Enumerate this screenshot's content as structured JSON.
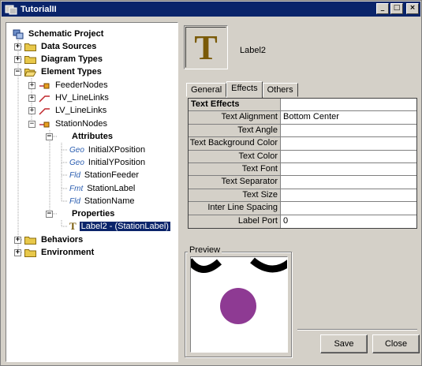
{
  "window": {
    "title": "TutorialII",
    "buttons": [
      "_",
      "□",
      "×"
    ]
  },
  "tree": {
    "root": "Schematic Project",
    "items": [
      {
        "label": "Data Sources",
        "bold": true
      },
      {
        "label": "Diagram Types",
        "bold": true
      },
      {
        "label": "Element Types",
        "bold": true
      },
      {
        "label": "FeederNodes"
      },
      {
        "label": "HV_LineLinks"
      },
      {
        "label": "LV_LineLinks"
      },
      {
        "label": "StationNodes"
      },
      {
        "label": "Attributes",
        "bold": true
      },
      {
        "tag": "Geo",
        "label": "InitialXPosition"
      },
      {
        "tag": "Geo",
        "label": "InitialYPosition"
      },
      {
        "tag": "Fld",
        "label": "StationFeeder"
      },
      {
        "tag": "Fmt",
        "label": "StationLabel"
      },
      {
        "tag": "Fld",
        "label": "StationName"
      },
      {
        "label": "Properties",
        "bold": true
      },
      {
        "label": "Label2 - (StationLabel)",
        "selected": true
      },
      {
        "label": "Behaviors",
        "bold": true
      },
      {
        "label": "Environment",
        "bold": true
      }
    ]
  },
  "header": {
    "icon_glyph": "T",
    "title": "Label2"
  },
  "tabs": [
    {
      "label": "General",
      "active": false
    },
    {
      "label": "Effects",
      "active": true
    },
    {
      "label": "Others",
      "active": false
    }
  ],
  "properties": {
    "header": "Text Effects",
    "rows": [
      {
        "name": "Text Alignment",
        "value": "Bottom Center"
      },
      {
        "name": "Text Angle",
        "value": ""
      },
      {
        "name": "Text Background Color",
        "value": ""
      },
      {
        "name": "Text Color",
        "value": ""
      },
      {
        "name": "Text Font",
        "value": ""
      },
      {
        "name": "Text Separator",
        "value": ""
      },
      {
        "name": "Text Size",
        "value": ""
      },
      {
        "name": "Inter Line Spacing",
        "value": ""
      },
      {
        "name": "Label Port",
        "value": "0"
      }
    ]
  },
  "preview": {
    "legend": "Preview",
    "circle_color": "#8e3a93"
  },
  "buttons": {
    "save": "Save",
    "close": "Close"
  },
  "colors": {
    "title_bar": "#0a246a",
    "selection": "#0a246a",
    "folder": "#e8c84a",
    "icon_t": "#7a5a08"
  }
}
